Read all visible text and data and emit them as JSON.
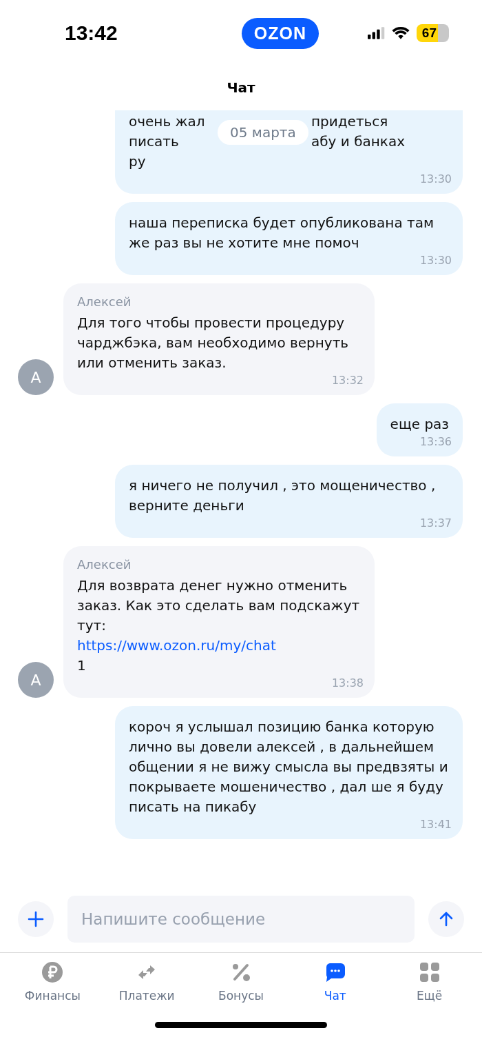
{
  "status_bar": {
    "time": "13:42",
    "logo": "OZON",
    "battery": "67"
  },
  "header": {
    "title": "Чат"
  },
  "date_pill": "05 марта",
  "messages": [
    {
      "kind": "outgoing",
      "lines": [
        [
          "очень жал",
          "придеться"
        ],
        [
          "писать",
          "абу и банках"
        ],
        [
          "ру"
        ]
      ],
      "time": "13:30"
    },
    {
      "kind": "outgoing",
      "text": "наша переписка будет опубликована там же раз вы не хотите мне помоч",
      "time": "13:30"
    },
    {
      "kind": "incoming",
      "author": "Алексей",
      "avatar": "А",
      "text": "Для того чтобы провести процедуру чарджбэка, вам необходимо вернуть или отменить заказ.",
      "time": "13:32"
    },
    {
      "kind": "outgoing",
      "text": "еще раз",
      "time": "13:36"
    },
    {
      "kind": "outgoing",
      "text": "я ничего не получил , это мощеничество , верните деньги",
      "time": "13:37"
    },
    {
      "kind": "incoming",
      "author": "Алексей",
      "avatar": "А",
      "text": "Для возврата денег нужно отменить заказ. Как это сделать вам подскажут тут:",
      "link": "https://www.ozon.ru/my/chat",
      "after": "1",
      "time": "13:38"
    },
    {
      "kind": "outgoing",
      "text": "короч я услышал позицию банка которую лично вы довели алексей , в дальнейшем общении я не вижу смысла вы предвзяты и покрываете мошеничество , дал ше я буду писать на пикабу",
      "time": "13:41"
    }
  ],
  "composer": {
    "placeholder": "Напишите сообщение"
  },
  "tabs": [
    {
      "label": "Финансы",
      "selected": false
    },
    {
      "label": "Платежи",
      "selected": false
    },
    {
      "label": "Бонусы",
      "selected": false
    },
    {
      "label": "Чат",
      "selected": true
    },
    {
      "label": "Ещё",
      "selected": false
    }
  ]
}
